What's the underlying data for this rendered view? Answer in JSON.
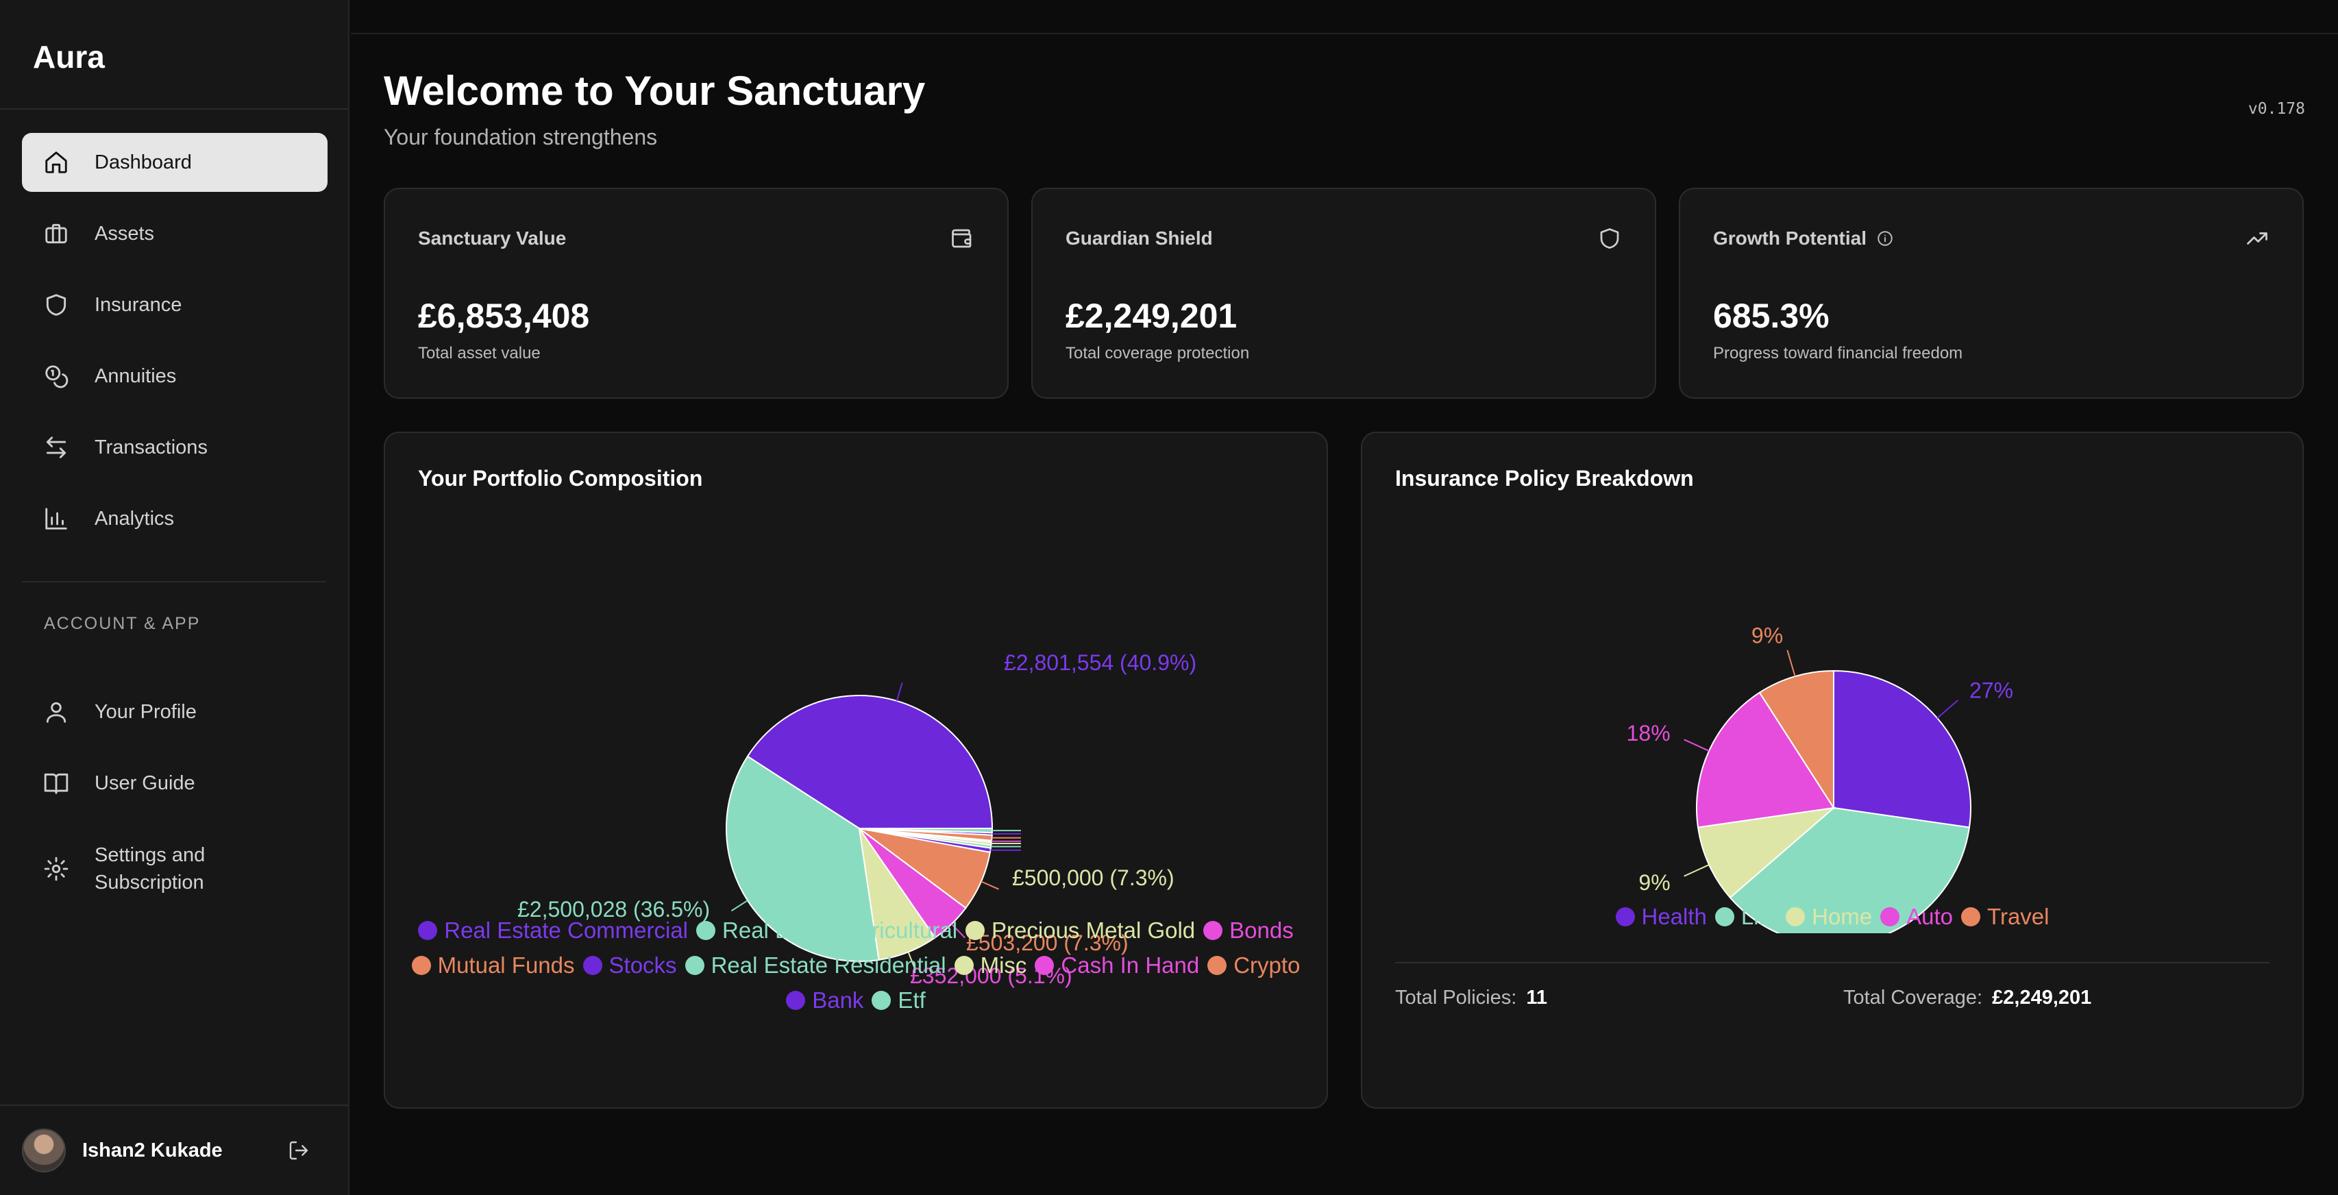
{
  "app": {
    "brand": "Aura",
    "version": "v0.178"
  },
  "sidebar": {
    "items": [
      {
        "label": "Dashboard",
        "icon": "home-icon",
        "active": true
      },
      {
        "label": "Assets",
        "icon": "briefcase-icon"
      },
      {
        "label": "Insurance",
        "icon": "shield-icon"
      },
      {
        "label": "Annuities",
        "icon": "coins-icon"
      },
      {
        "label": "Transactions",
        "icon": "arrows-left-right-icon"
      },
      {
        "label": "Analytics",
        "icon": "bar-chart-icon"
      }
    ],
    "section_label": "ACCOUNT & APP",
    "account_items": [
      {
        "label": "Your Profile",
        "icon": "user-icon"
      },
      {
        "label": "User Guide",
        "icon": "book-open-icon"
      },
      {
        "label": "Settings and Subscription",
        "label_line1": "Settings and",
        "label_line2": "Subscription",
        "icon": "gear-icon"
      }
    ],
    "user": {
      "name": "Ishan2 Kukade",
      "logout_icon": "logout-icon"
    }
  },
  "header": {
    "title": "Welcome to Your Sanctuary",
    "subtitle": "Your foundation strengthens"
  },
  "stats": [
    {
      "title": "Sanctuary Value",
      "value": "£6,853,408",
      "desc": "Total asset value",
      "icon": "wallet-icon"
    },
    {
      "title": "Guardian Shield",
      "value": "£2,249,201",
      "desc": "Total coverage protection",
      "icon": "shield-icon"
    },
    {
      "title": "Growth Potential",
      "value": "685.3%",
      "desc": "Progress toward financial freedom",
      "icon": "trending-up-icon",
      "info_icon": "info-icon"
    }
  ],
  "portfolio": {
    "title": "Your Portfolio Composition",
    "label_top": "£2,801,554 (40.9%)",
    "label_left": "£2,500,028 (36.5%)",
    "label_gold": "£500,000 (7.3%)",
    "label_mutual": "£503,200 (7.3%)",
    "label_bonds": "£352,000 (5.1%)"
  },
  "insurance": {
    "title": "Insurance Policy Breakdown",
    "total_policies_label": "Total Policies:",
    "total_policies_value": "11",
    "total_coverage_label": "Total Coverage:",
    "total_coverage_value": "£2,249,201"
  },
  "colors": {
    "purple": "#6d28d9",
    "mint": "#8adcc0",
    "pale_yellow": "#dde6a6",
    "magenta": "#e64ddc",
    "orange": "#e8875f",
    "background": "#0c0c0c",
    "card": "#171717"
  },
  "chart_data": [
    {
      "type": "pie",
      "title": "Your Portfolio Composition",
      "categories": [
        "Real Estate Commercial",
        "Real Estate Agricultural",
        "Precious Metal Gold",
        "Bonds",
        "Mutual Funds",
        "Stocks",
        "Real Estate Residential",
        "Misc",
        "Cash In Hand",
        "Crypto",
        "Bank",
        "Etf"
      ],
      "values": [
        2801554,
        2500028,
        500000,
        352000,
        503200,
        35000,
        25000,
        25000,
        12000,
        45000,
        20000,
        34626
      ],
      "value_labels": [
        "£2,801,554 (40.9%)",
        "£2,500,028 (36.5%)",
        "£500,000 (7.3%)",
        "£352,000 (5.1%)",
        "£503,200 (7.3%)",
        "",
        "",
        "",
        "",
        "",
        "",
        ""
      ],
      "colors": [
        "#6d28d9",
        "#8adcc0",
        "#dde6a6",
        "#e64ddc",
        "#e8875f",
        "#6d28d9",
        "#8adcc0",
        "#dde6a6",
        "#e64ddc",
        "#e8875f",
        "#6d28d9",
        "#8adcc0"
      ],
      "legend_position": "bottom"
    },
    {
      "type": "pie",
      "title": "Insurance Policy Breakdown",
      "categories": [
        "Health",
        "Life",
        "Home",
        "Auto",
        "Travel"
      ],
      "values": [
        27,
        36,
        9,
        18,
        9
      ],
      "value_labels": [
        "27%",
        "36%",
        "9%",
        "18%",
        "9%"
      ],
      "colors": [
        "#6d28d9",
        "#8adcc0",
        "#dde6a6",
        "#e64ddc",
        "#e8875f"
      ],
      "legend_position": "bottom"
    }
  ]
}
